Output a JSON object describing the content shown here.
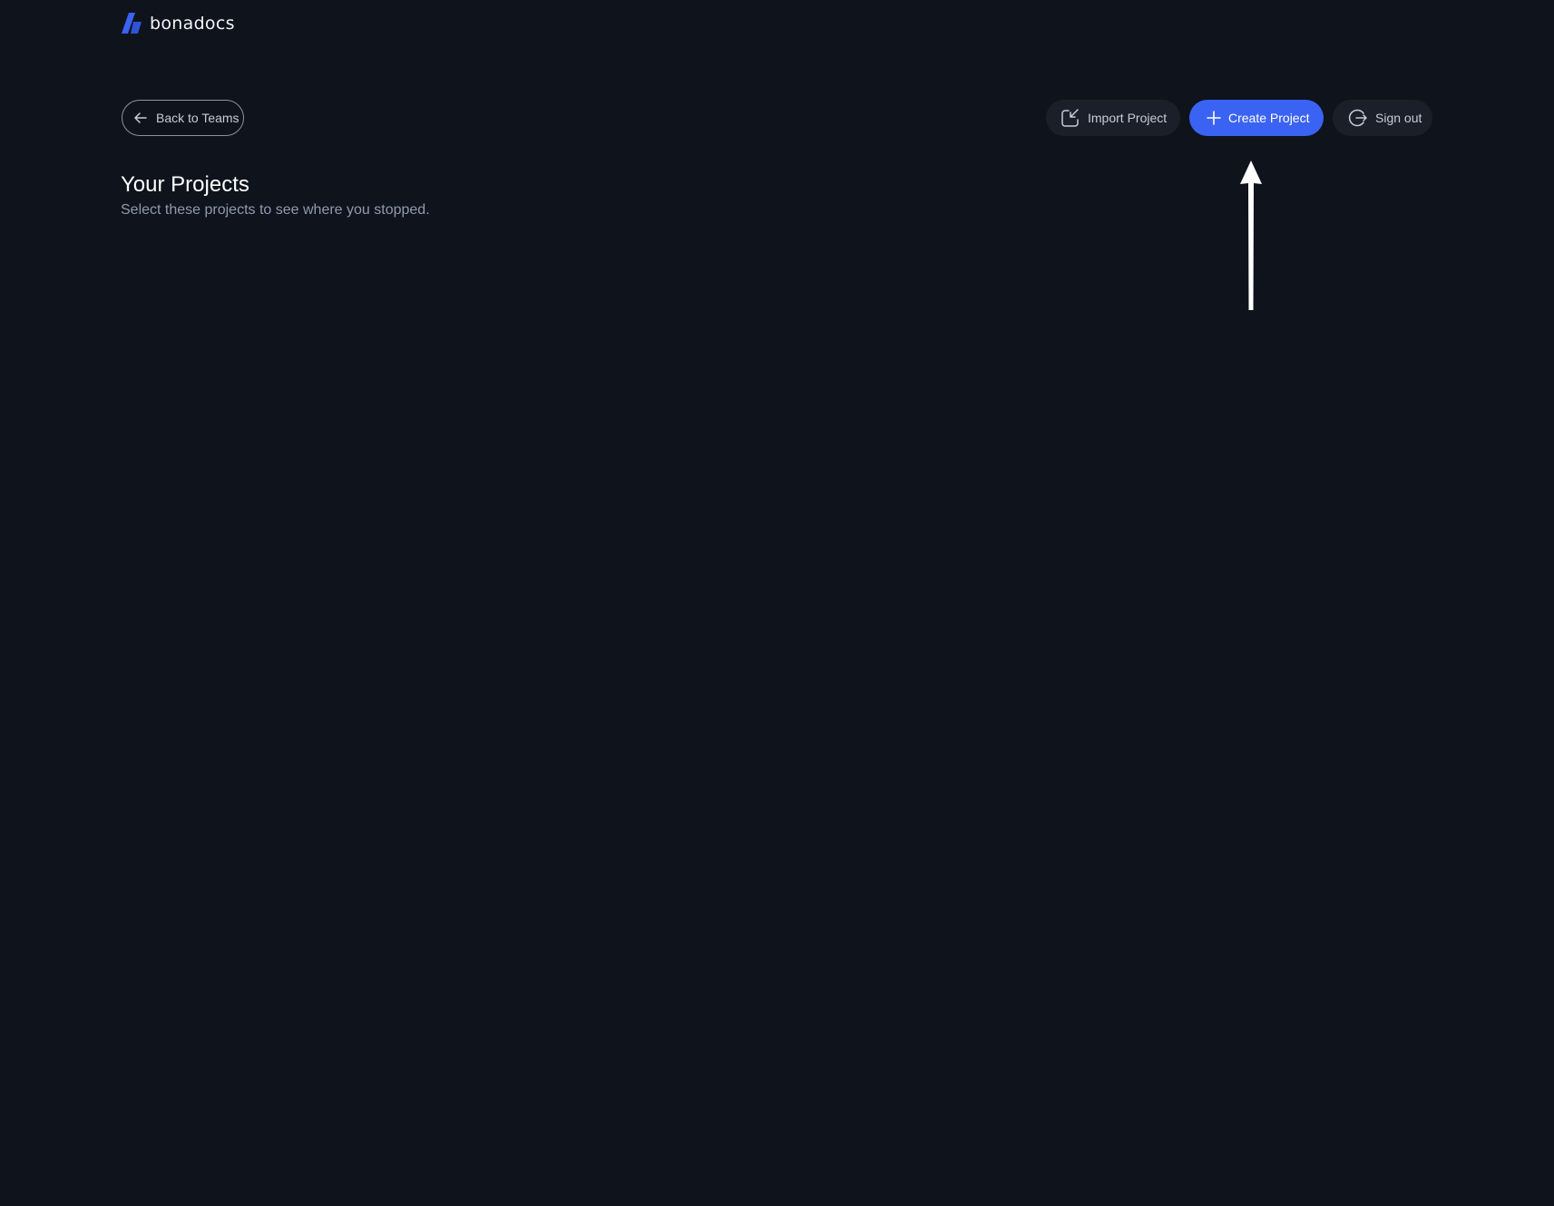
{
  "brand": {
    "name": "bonadocs",
    "logo_icon": "bonadocs-logo-icon",
    "accent_color": "#3b63f3"
  },
  "toolbar": {
    "back_label": "Back to Teams",
    "back_icon": "arrow-left-icon",
    "import_label": "Import Project",
    "import_icon": "import-icon",
    "create_label": "Create Project",
    "create_icon": "plus-icon",
    "signout_label": "Sign out",
    "signout_icon": "sign-out-icon"
  },
  "main": {
    "title": "Your Projects",
    "subtitle": "Select these projects to see where you stopped."
  },
  "colors": {
    "background": "#0f131c",
    "button_dark": "#1a1f2a",
    "text_muted": "#8f9ab0"
  }
}
